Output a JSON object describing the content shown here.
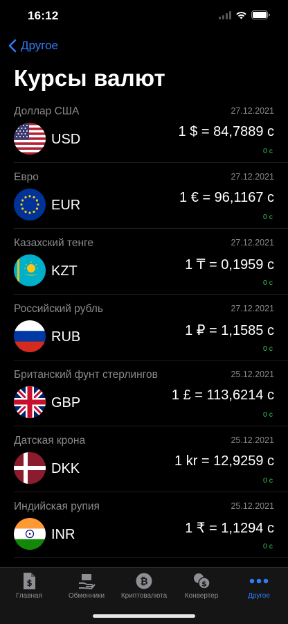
{
  "status": {
    "time": "16:12"
  },
  "nav": {
    "back_label": "Другое"
  },
  "page": {
    "title": "Курсы валют"
  },
  "rates": [
    {
      "name": "Доллар США",
      "date": "27.12.2021",
      "code": "USD",
      "rate": "1 $ = 84,7889 с",
      "change": "0 с",
      "flag": "us-flag"
    },
    {
      "name": "Евро",
      "date": "27.12.2021",
      "code": "EUR",
      "rate": "1 € = 96,1167 с",
      "change": "0 с",
      "flag": "eu-flag"
    },
    {
      "name": "Казахский тенге",
      "date": "27.12.2021",
      "code": "KZT",
      "rate": "1 ₸ = 0,1959 с",
      "change": "0 с",
      "flag": "kz-flag"
    },
    {
      "name": "Российский рубль",
      "date": "27.12.2021",
      "code": "RUB",
      "rate": "1 ₽ = 1,1585 с",
      "change": "0 с",
      "flag": "ru-flag"
    },
    {
      "name": "Британский фунт стерлингов",
      "date": "25.12.2021",
      "code": "GBP",
      "rate": "1 £ = 113,6214 с",
      "change": "0 с",
      "flag": "gb-flag"
    },
    {
      "name": "Датская крона",
      "date": "25.12.2021",
      "code": "DKK",
      "rate": "1 kr = 12,9259 с",
      "change": "0 с",
      "flag": "dk-flag"
    },
    {
      "name": "Индийская рупия",
      "date": "25.12.2021",
      "code": "INR",
      "rate": "1 ₹ = 1,1294 с",
      "change": "0 с",
      "flag": "in-flag"
    }
  ],
  "tabs": [
    {
      "label": "Главная",
      "icon": "dollar-doc-icon",
      "active": false
    },
    {
      "label": "Обменники",
      "icon": "exchange-hand-icon",
      "active": false
    },
    {
      "label": "Криптовалюта",
      "icon": "bitcoin-icon",
      "active": false
    },
    {
      "label": "Конвертер",
      "icon": "converter-icon",
      "active": false
    },
    {
      "label": "Другое",
      "icon": "more-icon",
      "active": true
    }
  ],
  "colors": {
    "accent": "#2f7cf6",
    "change_positive": "#35c759",
    "muted": "#8a8a8a"
  }
}
